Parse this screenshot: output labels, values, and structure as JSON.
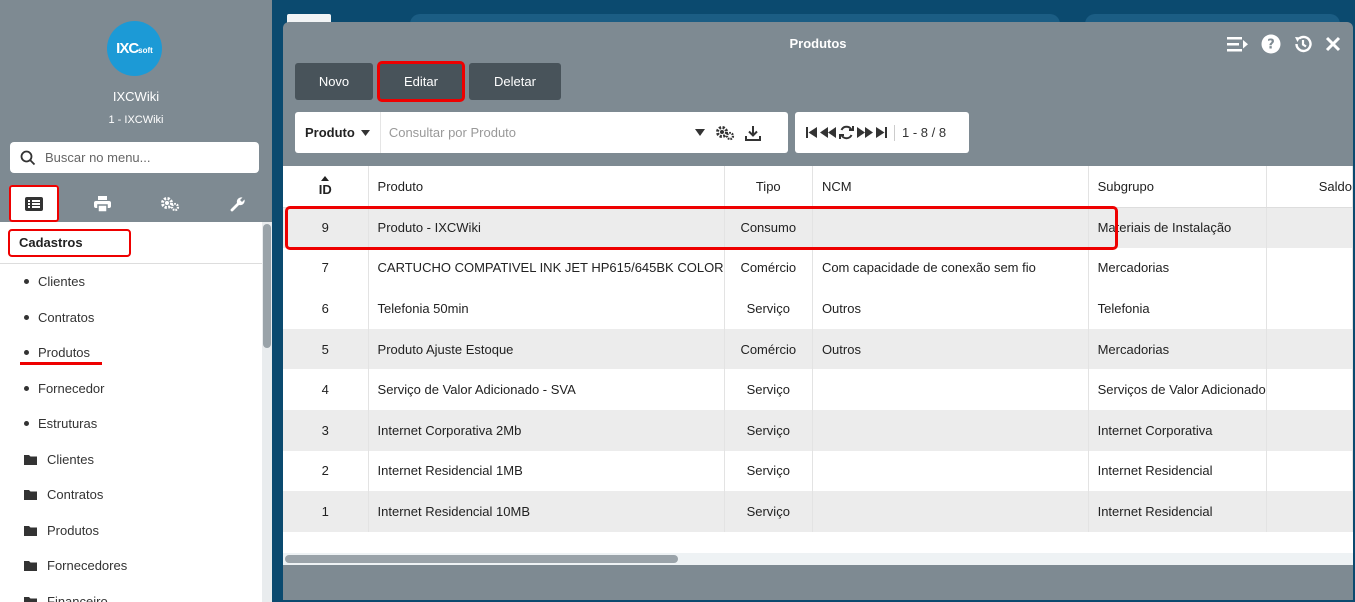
{
  "sidebar": {
    "logo_text": "IXC",
    "logo_sub": "soft",
    "app_name": "IXCWiki",
    "app_sub": "1 - IXCWiki",
    "search_placeholder": "Buscar no menu...",
    "section_title": "Cadastros",
    "items": [
      {
        "label": "Clientes",
        "type": "bullet"
      },
      {
        "label": "Contratos",
        "type": "bullet"
      },
      {
        "label": "Produtos",
        "type": "bullet"
      },
      {
        "label": "Fornecedor",
        "type": "bullet"
      },
      {
        "label": "Estruturas",
        "type": "bullet"
      },
      {
        "label": "Clientes",
        "type": "folder"
      },
      {
        "label": "Contratos",
        "type": "folder"
      },
      {
        "label": "Produtos",
        "type": "folder"
      },
      {
        "label": "Fornecedores",
        "type": "folder"
      },
      {
        "label": "Financeiro",
        "type": "folder"
      }
    ]
  },
  "modal": {
    "title": "Produtos",
    "buttons": {
      "new": "Novo",
      "edit": "Editar",
      "delete": "Deletar"
    },
    "search": {
      "field_label": "Produto",
      "placeholder": "Consultar por Produto"
    },
    "pager": {
      "count": "1 - 8 / 8"
    }
  },
  "grid": {
    "columns": [
      "ID",
      "Produto",
      "Tipo",
      "NCM",
      "Subgrupo",
      "Saldo"
    ],
    "rows": [
      {
        "id": "9",
        "produto": "Produto - IXCWiki",
        "tipo": "Consumo",
        "ncm": "",
        "subgrupo": "Materiais de Instalação"
      },
      {
        "id": "7",
        "produto": "CARTUCHO COMPATIVEL INK JET HP615/645BK COLOR",
        "tipo": "Comércio",
        "ncm": "Com capacidade de conexão sem fio",
        "subgrupo": "Mercadorias"
      },
      {
        "id": "6",
        "produto": "Telefonia 50min",
        "tipo": "Serviço",
        "ncm": "Outros",
        "subgrupo": "Telefonia"
      },
      {
        "id": "5",
        "produto": "Produto Ajuste Estoque",
        "tipo": "Comércio",
        "ncm": "Outros",
        "subgrupo": "Mercadorias"
      },
      {
        "id": "4",
        "produto": "Serviço de Valor Adicionado - SVA",
        "tipo": "Serviço",
        "ncm": "",
        "subgrupo": "Serviços de Valor Adicionado"
      },
      {
        "id": "3",
        "produto": "Internet Corporativa 2Mb",
        "tipo": "Serviço",
        "ncm": "",
        "subgrupo": "Internet Corporativa"
      },
      {
        "id": "2",
        "produto": "Internet Residencial 1MB",
        "tipo": "Serviço",
        "ncm": "",
        "subgrupo": "Internet Residencial"
      },
      {
        "id": "1",
        "produto": "Internet Residencial 10MB",
        "tipo": "Serviço",
        "ncm": "",
        "subgrupo": "Internet Residencial"
      }
    ]
  },
  "colors": {
    "highlight": "#e00000",
    "sidebar_bg": "#7e8a92",
    "button_bg": "#48535a",
    "page_bg": "#0b4a6f"
  }
}
